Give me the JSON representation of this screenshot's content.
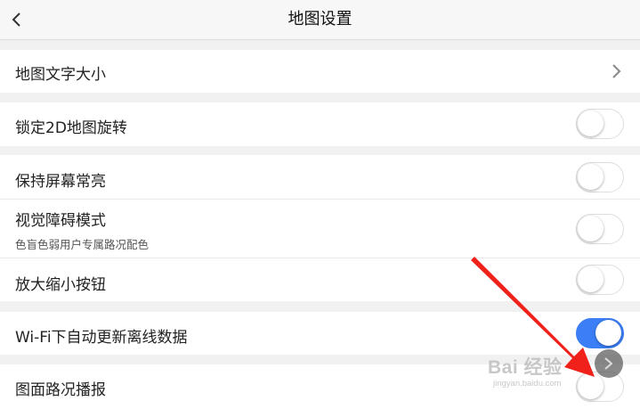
{
  "header": {
    "title": "地图设置"
  },
  "settings": [
    {
      "label": "地图文字大小"
    },
    {
      "label": "锁定2D地图旋转",
      "enabled": false
    },
    {
      "label": "保持屏幕常亮",
      "enabled": false
    },
    {
      "label": "视觉障碍模式",
      "sublabel": "色盲色弱用户专属路况配色",
      "enabled": false
    },
    {
      "label": "放大缩小按钮",
      "enabled": false
    },
    {
      "label": "Wi-Fi下自动更新离线数据",
      "enabled": true
    },
    {
      "label": "图面路况播报",
      "enabled": false
    }
  ],
  "watermark": {
    "text": "Bai 经验",
    "url": "jingyan.baidu.com"
  },
  "colors": {
    "accent": "#3b7ef5",
    "annotation_arrow": "#f0201a"
  }
}
